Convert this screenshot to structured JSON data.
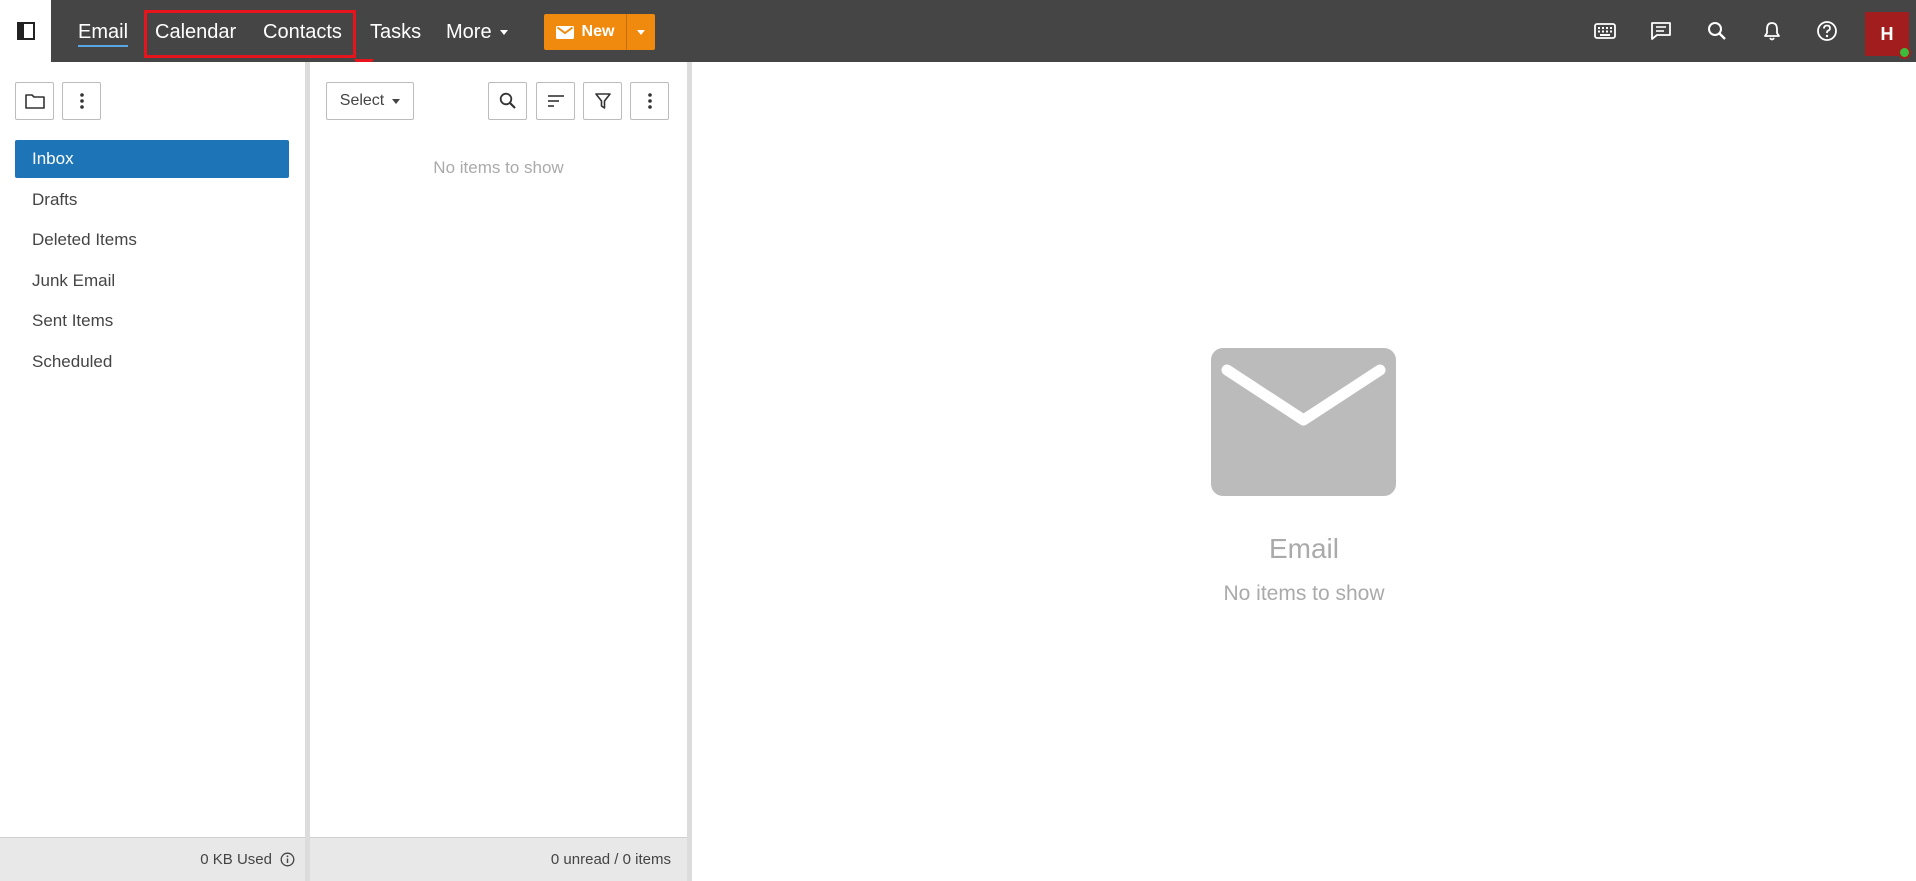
{
  "nav": {
    "email": "Email",
    "calendar": "Calendar",
    "contacts": "Contacts",
    "tasks": "Tasks",
    "more": "More",
    "new_label": "New"
  },
  "user": {
    "initial": "H",
    "presence_color": "#3dbb3d"
  },
  "folders": [
    "Inbox",
    "Drafts",
    "Deleted Items",
    "Junk Email",
    "Sent Items",
    "Scheduled"
  ],
  "folder_footer": "0 KB Used",
  "list": {
    "select_label": "Select",
    "empty_text": "No items to show",
    "footer": "0 unread / 0 items"
  },
  "reading": {
    "title": "Email",
    "subtitle": "No items to show"
  },
  "colors": {
    "topbar": "#454545",
    "accent_new": "#f08a0f",
    "active_folder": "#1d75b8",
    "avatar": "#a21e1e",
    "annotation": "#e8141c"
  },
  "icons": [
    "sidebar-toggle-icon",
    "mail-icon",
    "keyboard-icon",
    "chat-icon",
    "search-icon",
    "bell-icon",
    "help-icon",
    "folder-icon",
    "more-vertical-icon",
    "sort-icon",
    "filter-icon",
    "info-icon",
    "envelope-icon"
  ]
}
